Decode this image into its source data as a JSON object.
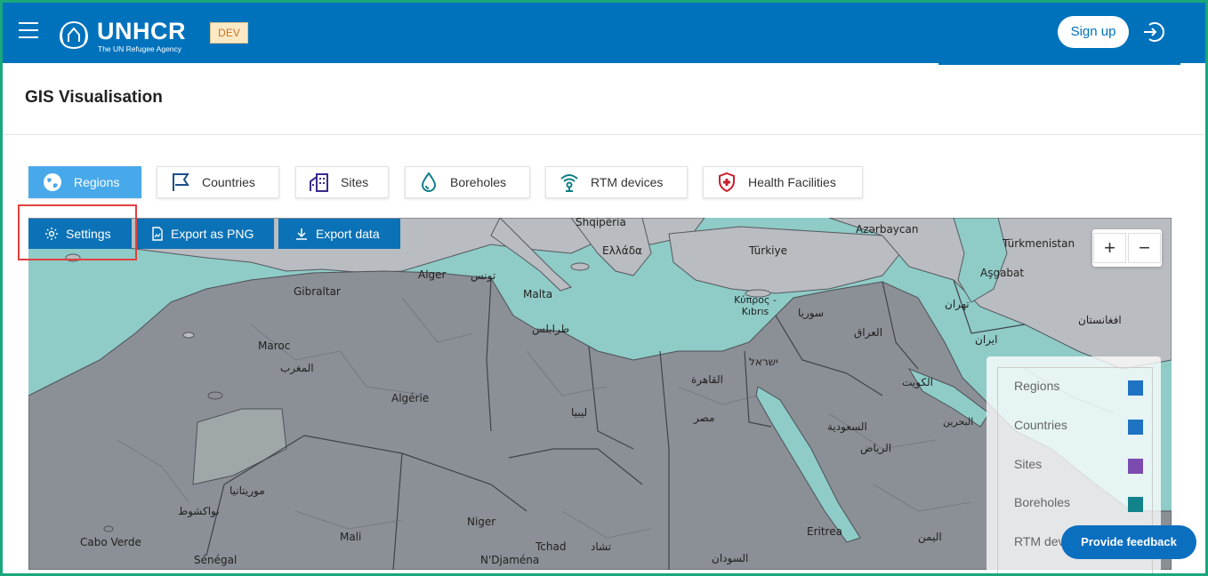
{
  "header": {
    "brand": "UNHCR",
    "brand_sub": "The UN Refugee Agency",
    "env": "DEV",
    "signup_label": "Sign up"
  },
  "page": {
    "title": "GIS Visualisation"
  },
  "layers": [
    {
      "label": "Regions",
      "icon": "globe-icon",
      "active": true
    },
    {
      "label": "Countries",
      "icon": "flag-icon",
      "active": false
    },
    {
      "label": "Sites",
      "icon": "buildings-icon",
      "active": false
    },
    {
      "label": "Boreholes",
      "icon": "water-drop-icon",
      "active": false
    },
    {
      "label": "RTM devices",
      "icon": "wireless-icon",
      "active": false
    },
    {
      "label": "Health Facilities",
      "icon": "health-shield-icon",
      "active": false
    }
  ],
  "toolbar": {
    "settings_label": "Settings",
    "export_png_label": "Export as PNG",
    "export_data_label": "Export data"
  },
  "zoom": {
    "in": "+",
    "out": "−"
  },
  "legend": [
    {
      "label": "Regions",
      "color": "#1f73c2"
    },
    {
      "label": "Countries",
      "color": "#1f73c2"
    },
    {
      "label": "Sites",
      "color": "#7b4bb0"
    },
    {
      "label": "Boreholes",
      "color": "#12838a"
    },
    {
      "label": "RTM dev"
    }
  ],
  "map_labels": [
    "Shqipëria",
    "Ελλάδα",
    "Türkiye",
    "Azərbaycan",
    "Türkmenistan",
    "Aşgabat",
    "Alger",
    "تونس",
    "Gibraltar",
    "Malta",
    "Κύπρος - Kıbrıs",
    "سوريا",
    "تهران",
    "Maroc",
    "المغرب",
    "طرابلس",
    "العراق",
    "ايران",
    "ישראל",
    "الكويت",
    "Algérie",
    "القاهرة",
    "ليبيا",
    "مصر",
    "السعودية",
    "الرياض",
    "البحرين",
    "موريتانيا",
    "نواكشوط",
    "Niger",
    "Mali",
    "Tchad",
    "تشاد",
    "N'Djaména",
    "Cabo Verde",
    "Sénégal",
    "Eritrea",
    "اليمن",
    "السودان",
    "افغانستان"
  ],
  "feedback_label": "Provide feedback"
}
